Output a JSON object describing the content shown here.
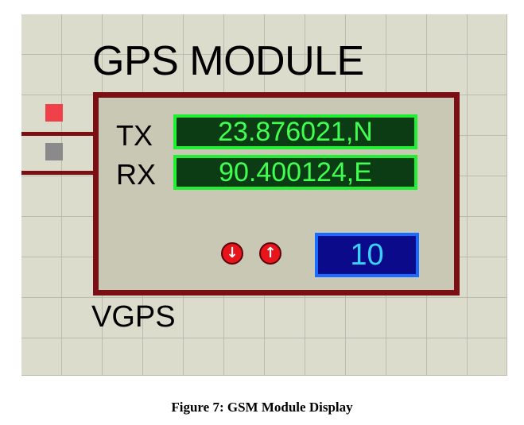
{
  "component": {
    "title": "GPS MODULE",
    "reference": "VGPS",
    "pins": [
      {
        "label": "TX",
        "indicator_color": "#f0404a"
      },
      {
        "label": "RX",
        "indicator_color": "#8a8a8a"
      }
    ],
    "latitude_display": "23.876021,N",
    "longitude_display": "90.400124,E",
    "buttons": [
      {
        "icon": "arrow-down-icon",
        "glyph": "↓"
      },
      {
        "icon": "arrow-up-icon",
        "glyph": "↑"
      }
    ],
    "counter_value": "10"
  },
  "colors": {
    "wire": "#7a0f14",
    "lcd_text": "#40ff50",
    "lcd_background": "#0b3c14",
    "counter_background": "#0a0a8a",
    "counter_text": "#3ad0ff",
    "button": "#e8141c"
  },
  "caption": "Figure 7: GSM Module Display"
}
